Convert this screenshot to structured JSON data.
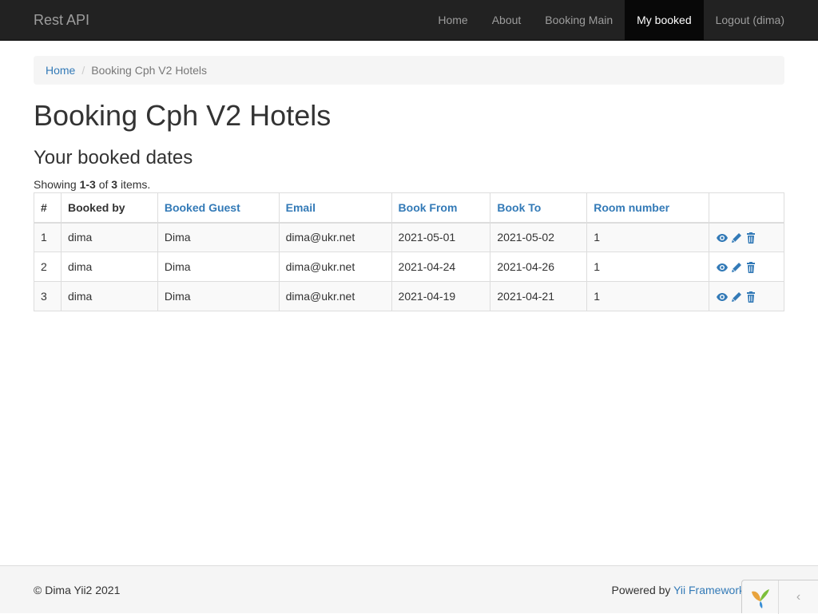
{
  "navbar": {
    "brand": "Rest API",
    "items": [
      {
        "label": "Home"
      },
      {
        "label": "About"
      },
      {
        "label": "Booking Main"
      },
      {
        "label": "My booked"
      },
      {
        "label": "Logout (dima)"
      }
    ]
  },
  "breadcrumb": {
    "home": "Home",
    "current": "Booking Cph V2 Hotels"
  },
  "page": {
    "title": "Booking Cph V2 Hotels",
    "subtitle": "Your booked dates"
  },
  "summary": {
    "prefix": "Showing ",
    "range": "1-3",
    "of": " of ",
    "total": "3",
    "suffix": " items."
  },
  "table": {
    "headers": [
      "#",
      "Booked by",
      "Booked Guest",
      "Email",
      "Book From",
      "Book To",
      "Room number"
    ],
    "rows": [
      {
        "n": "1",
        "by": "dima",
        "guest": "Dima",
        "email": "dima@ukr.net",
        "from": "2021-05-01",
        "to": "2021-05-02",
        "room": "1"
      },
      {
        "n": "2",
        "by": "dima",
        "guest": "Dima",
        "email": "dima@ukr.net",
        "from": "2021-04-24",
        "to": "2021-04-26",
        "room": "1"
      },
      {
        "n": "3",
        "by": "dima",
        "guest": "Dima",
        "email": "dima@ukr.net",
        "from": "2021-04-19",
        "to": "2021-04-21",
        "room": "1"
      }
    ],
    "action_icons": [
      "eye-icon",
      "pencil-icon",
      "trash-icon"
    ]
  },
  "footer": {
    "copyright": "© Dima Yii2 2021",
    "powered_prefix": "Powered by ",
    "powered_link": "Yii Framework"
  },
  "debug_toolbar": {
    "toggle": "‹"
  },
  "colors": {
    "navbar_bg": "#222222",
    "link": "#337ab7",
    "active_nav_bg": "#080808"
  }
}
